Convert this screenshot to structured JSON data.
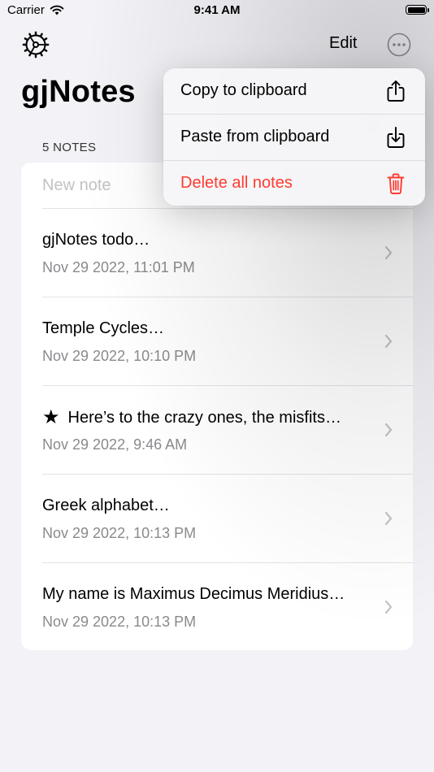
{
  "status": {
    "carrier": "Carrier",
    "time": "9:41 AM",
    "battery_level": 1.0
  },
  "nav": {
    "edit_label": "Edit"
  },
  "app": {
    "title": "gjNotes",
    "note_count_label": "5 NOTES"
  },
  "new_note": {
    "placeholder": "New note"
  },
  "notes": [
    {
      "title": "gjNotes todo…",
      "date": "Nov 29 2022, 11:01 PM",
      "starred": false
    },
    {
      "title": "Temple Cycles…",
      "date": "Nov 29 2022, 10:10 PM",
      "starred": false
    },
    {
      "title": "Here’s to the crazy ones, the misfits…",
      "date": "Nov 29 2022, 9:46 AM",
      "starred": true
    },
    {
      "title": "Greek alphabet…",
      "date": "Nov 29 2022, 10:13 PM",
      "starred": false
    },
    {
      "title": "My name is Maximus Decimus Meridius…",
      "date": "Nov 29 2022, 10:13 PM",
      "starred": false
    }
  ],
  "menu": {
    "items": [
      {
        "label": "Copy to clipboard",
        "icon": "share-up-icon"
      },
      {
        "label": "Paste from clipboard",
        "icon": "share-down-icon"
      },
      {
        "label": "Delete all notes",
        "icon": "trash-icon",
        "destructive": true
      }
    ]
  },
  "colors": {
    "accent": "#007aff",
    "destructive": "#ff3b30",
    "background": "#f2f2f7"
  }
}
